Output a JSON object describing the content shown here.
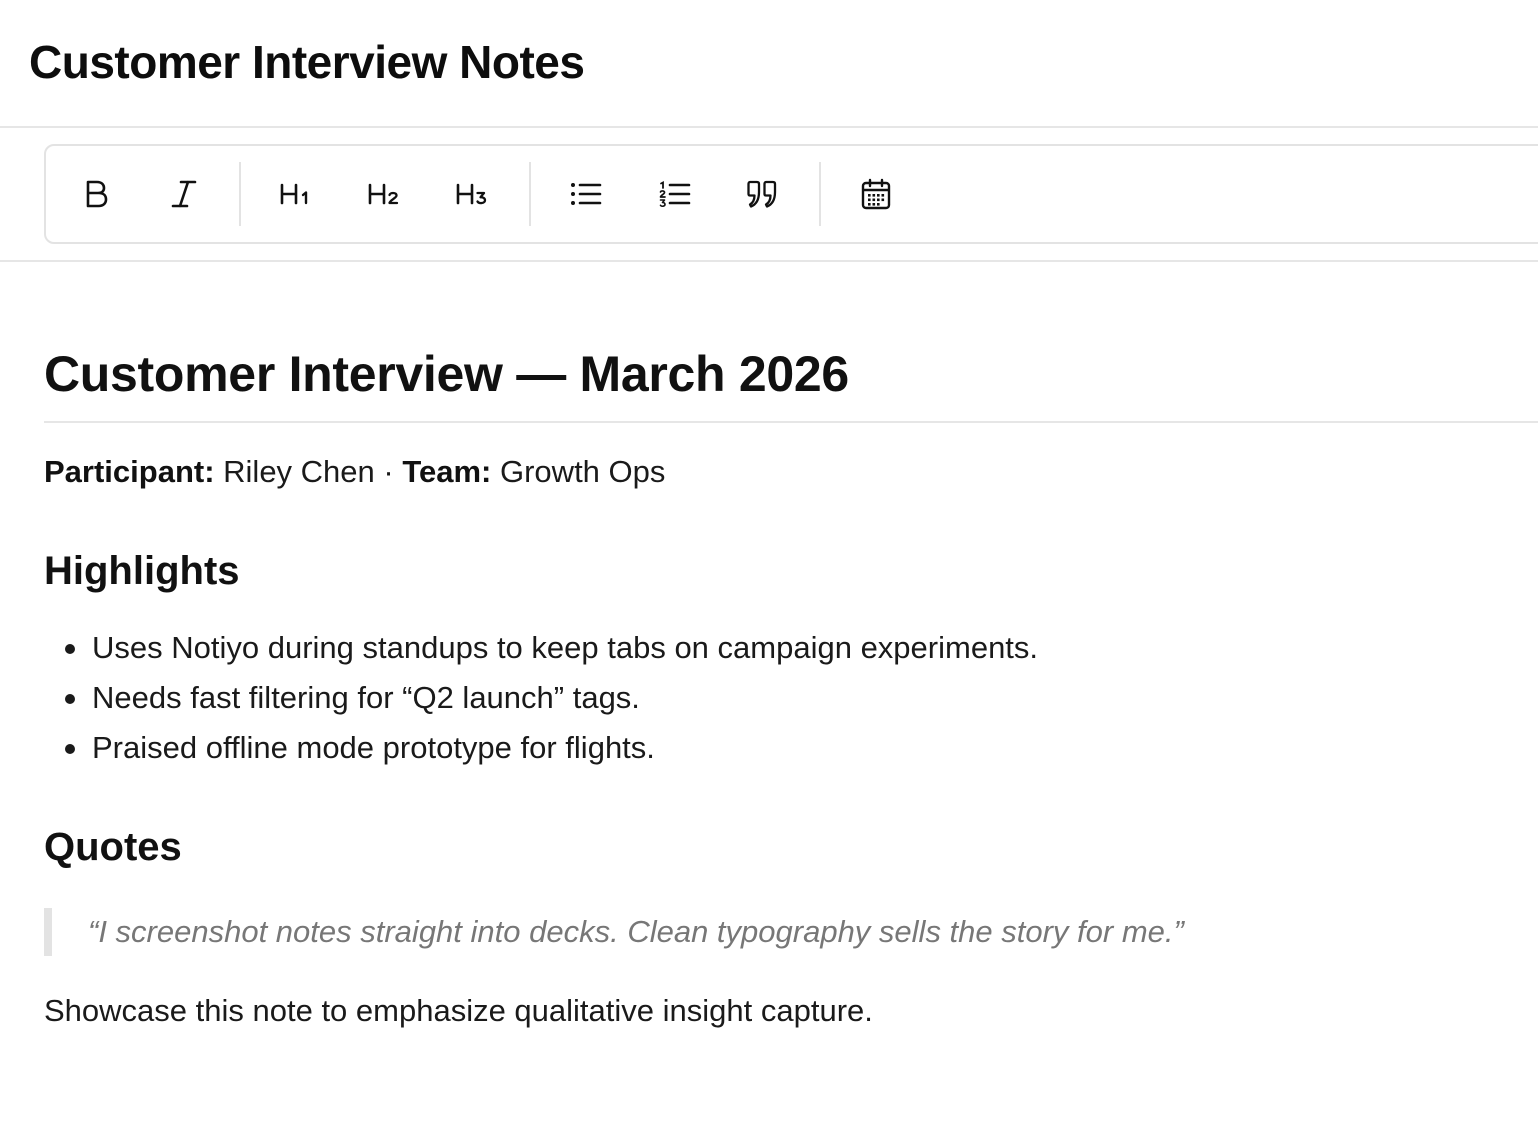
{
  "app": {
    "title": "Customer Interview Notes"
  },
  "toolbar": {
    "buttons": [
      {
        "name": "bold",
        "icon": "bold-icon"
      },
      {
        "name": "italic",
        "icon": "italic-icon"
      },
      {
        "name": "heading-1",
        "icon": "heading-1-icon"
      },
      {
        "name": "heading-2",
        "icon": "heading-2-icon"
      },
      {
        "name": "heading-3",
        "icon": "heading-3-icon"
      },
      {
        "name": "bullet-list",
        "icon": "bullet-list-icon"
      },
      {
        "name": "numbered-list",
        "icon": "numbered-list-icon"
      },
      {
        "name": "blockquote",
        "icon": "quote-icon"
      },
      {
        "name": "insert-date",
        "icon": "calendar-icon"
      }
    ]
  },
  "document": {
    "title": "Customer Interview — March 2026",
    "meta": {
      "participant_label": "Participant:",
      "participant_value": "Riley Chen",
      "separator": "·",
      "team_label": "Team:",
      "team_value": "Growth Ops"
    },
    "highlights_heading": "Highlights",
    "highlights": [
      "Uses Notiyo during standups to keep tabs on campaign experiments.",
      "Needs fast filtering for “Q2 launch” tags.",
      "Praised offline mode prototype for flights."
    ],
    "quotes_heading": "Quotes",
    "quote": "“I screenshot notes straight into decks. Clean typography sells the story for me.”",
    "closing": "Showcase this note to emphasize qualitative insight capture."
  },
  "colors": {
    "text": "#111111",
    "muted_quote": "#777777",
    "border": "#e3e3e3"
  }
}
